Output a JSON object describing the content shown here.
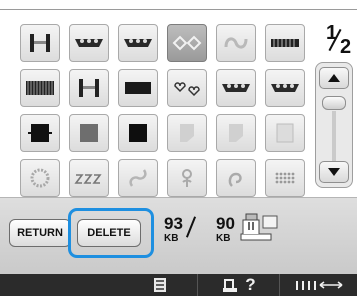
{
  "page_indicator": {
    "current": "1",
    "total": "2"
  },
  "icons": {
    "grid": [
      [
        "hanger-pattern-icon",
        "triple-heart-pattern-icon",
        "triple-heart-pattern-icon",
        "diamond-lace-pattern-icon",
        "scroll-ornament-icon",
        "ruler-border-pattern-icon"
      ],
      [
        "striped-border-pattern-icon",
        "hanger-pattern-icon",
        "black-bar-pattern-icon",
        "heart-outline-pattern-icon",
        "triple-heart-pattern-icon",
        "triple-heart-pattern-icon"
      ],
      [
        "black-block-pattern-icon",
        "gray-block-pattern-icon",
        "black-square-pattern-icon",
        "light-panel-pattern-icon",
        "light-panel-pattern-icon",
        "dotted-panel-pattern-icon"
      ],
      [
        "lace-round-icon",
        "zigzag-text-icon",
        "filigree-icon",
        "flower-motif-icon",
        "scroll-motif-icon",
        "dotted-grid-icon"
      ]
    ]
  },
  "buttons": {
    "return": "RETURN",
    "delete": "DELETE"
  },
  "memory": {
    "left_value": "93",
    "left_unit": "KB",
    "right_value": "90",
    "right_unit": "KB"
  },
  "bottom_bar": {
    "question": "?"
  },
  "colors": {
    "highlight": "#1e8fe0",
    "bar": "#2b2b2b"
  }
}
